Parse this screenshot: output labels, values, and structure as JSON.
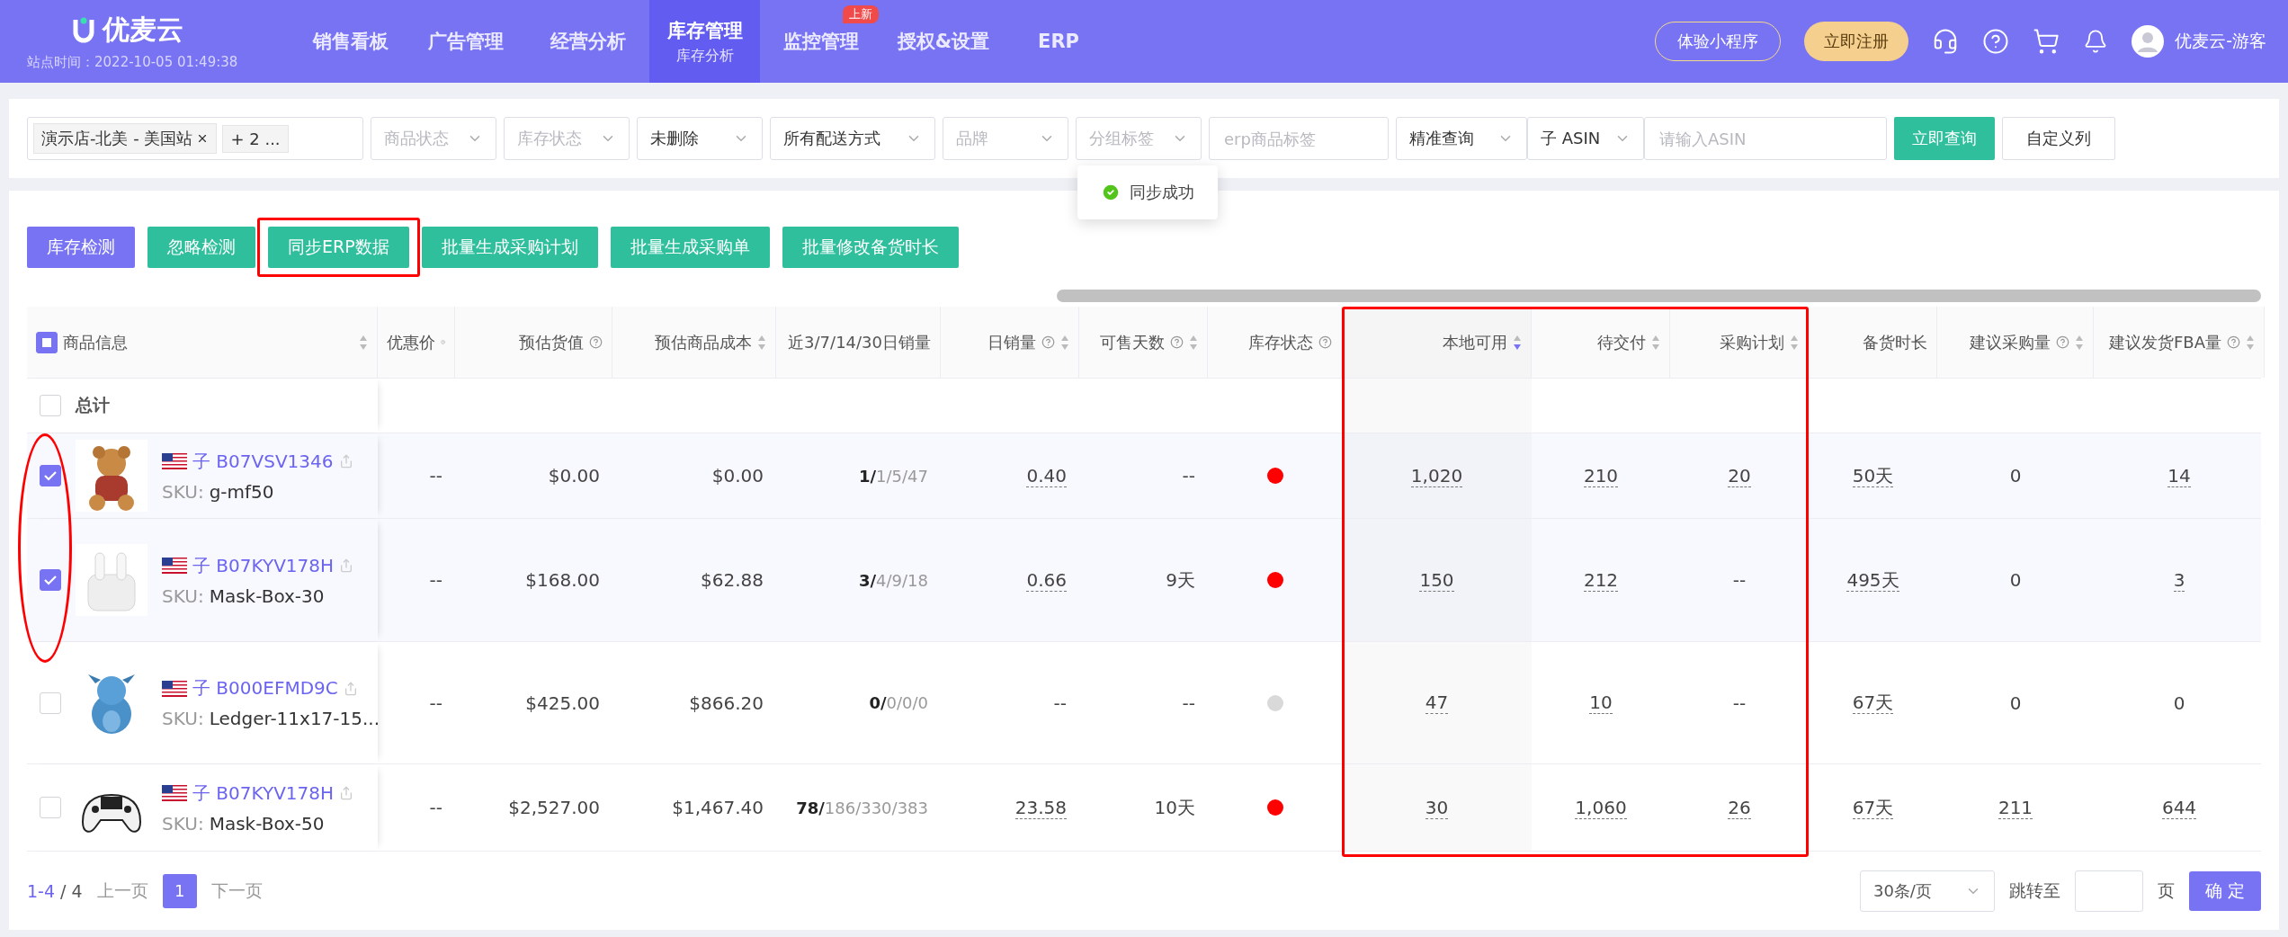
{
  "header": {
    "logo": "优麦云",
    "site_time": "站点时间：2022-10-05 01:49:38",
    "nav": [
      {
        "label": "销售看板",
        "selected": false
      },
      {
        "label": "广告管理",
        "selected": false
      },
      {
        "label": "经营分析",
        "selected": false
      },
      {
        "label": "库存管理",
        "sub": "库存分析",
        "selected": true
      },
      {
        "label": "监控管理",
        "badge": "上新",
        "selected": false
      },
      {
        "label": "授权&设置",
        "selected": false
      },
      {
        "label": "ERP",
        "selected": false
      }
    ],
    "trial_button": "体验小程序",
    "register_button": "立即注册",
    "user": "优麦云-游客"
  },
  "filters": {
    "store": {
      "tag": "演示店-北美 - 美国站",
      "more": "+ 2 ..."
    },
    "selects": [
      {
        "placeholder": "商品状态"
      },
      {
        "placeholder": "库存状态"
      },
      {
        "value": "未删除"
      },
      {
        "value": "所有配送方式"
      },
      {
        "placeholder": "品牌"
      },
      {
        "placeholder": "分组标签"
      }
    ],
    "tag_field": {
      "placeholder": "erp商品标签"
    },
    "mode_select": "精准查询",
    "asin_select": "子 ASIN",
    "asin_field": {
      "placeholder": "请输入ASIN"
    },
    "query_button": "立即查询",
    "custom_button": "自定义列"
  },
  "toast": "同步成功",
  "actions": [
    {
      "label": "库存检测",
      "kind": "primary",
      "highlighted": false
    },
    {
      "label": "忽略检测",
      "kind": "teal",
      "highlighted": false
    },
    {
      "label": "同步ERP数据",
      "kind": "teal",
      "highlighted": true
    },
    {
      "label": "批量生成采购计划",
      "kind": "teal",
      "highlighted": false
    },
    {
      "label": "批量生成采购单",
      "kind": "teal",
      "highlighted": false
    },
    {
      "label": "批量修改备货时长",
      "kind": "teal",
      "highlighted": false
    }
  ],
  "table": {
    "select_all": {
      "partial": true
    },
    "columns": [
      {
        "label": "商品信息",
        "help": false,
        "sortable": true,
        "descending": false
      },
      {
        "label": "优惠价",
        "help": true,
        "sortable": false
      },
      {
        "label": "预估货值",
        "help": true,
        "sortable": false
      },
      {
        "label": "预估商品成本",
        "help": false,
        "sortable": true,
        "descending": false
      },
      {
        "label": "近3/7/14/30日销量",
        "help": false,
        "sortable": false
      },
      {
        "label": "日销量",
        "help": true,
        "sortable": true,
        "descending": false
      },
      {
        "label": "可售天数",
        "help": true,
        "sortable": true,
        "descending": false
      },
      {
        "label": "库存状态",
        "help": true,
        "sortable": false
      },
      {
        "label": "本地可用",
        "help": false,
        "sortable": true,
        "descending": true
      },
      {
        "label": "待交付",
        "help": false,
        "sortable": true,
        "descending": false
      },
      {
        "label": "采购计划",
        "help": false,
        "sortable": true,
        "descending": false
      },
      {
        "label": "备货时长",
        "help": false,
        "sortable": false
      },
      {
        "label": "建议采购量",
        "help": true,
        "sortable": true,
        "descending": false
      },
      {
        "label": "建议发货FBA量",
        "help": true,
        "sortable": true,
        "descending": false
      }
    ],
    "total": {
      "label": "总计",
      "checked": false
    },
    "rows": [
      {
        "checked": true,
        "cells": [
          {
            "kind": "product",
            "child": "子",
            "asin": "B07VSV1346",
            "sku_label": "SKU:",
            "sku": "g-mf50"
          },
          {
            "kind": "text",
            "text": "--"
          },
          {
            "kind": "text",
            "text": "$0.00"
          },
          {
            "kind": "text",
            "text": "$0.00"
          },
          {
            "kind": "sales",
            "bold": "1/",
            "rest": "1/5/47"
          },
          {
            "kind": "text",
            "text": "0.40",
            "dotted": true
          },
          {
            "kind": "text",
            "text": "--"
          },
          {
            "kind": "dot",
            "color": "#ff0000"
          },
          {
            "kind": "text",
            "text": "1,020",
            "dotted": true
          },
          {
            "kind": "text",
            "text": "210",
            "dotted": true
          },
          {
            "kind": "text",
            "text": "20",
            "dotted": true
          },
          {
            "kind": "text",
            "text": "50天",
            "dotted": true
          },
          {
            "kind": "text",
            "text": "0"
          },
          {
            "kind": "text",
            "text": "14",
            "dotted": true
          }
        ]
      },
      {
        "checked": true,
        "cells": [
          {
            "kind": "product",
            "child": "子",
            "asin": "B07KYV178H",
            "sku_label": "SKU:",
            "sku": "Mask-Box-30"
          },
          {
            "kind": "text",
            "text": "--"
          },
          {
            "kind": "text",
            "text": "$168.00"
          },
          {
            "kind": "text",
            "text": "$62.88"
          },
          {
            "kind": "sales",
            "bold": "3/",
            "rest": "4/9/18"
          },
          {
            "kind": "text",
            "text": "0.66",
            "dotted": true
          },
          {
            "kind": "text",
            "text": "9天"
          },
          {
            "kind": "dot",
            "color": "#ff0000"
          },
          {
            "kind": "text",
            "text": "150",
            "dotted": true
          },
          {
            "kind": "text",
            "text": "212",
            "dotted": true
          },
          {
            "kind": "text",
            "text": "--"
          },
          {
            "kind": "text",
            "text": "495天",
            "dotted": true
          },
          {
            "kind": "text",
            "text": "0"
          },
          {
            "kind": "text",
            "text": "3",
            "dotted": true
          }
        ]
      },
      {
        "checked": false,
        "cells": [
          {
            "kind": "product",
            "child": "子",
            "asin": "B000EFMD9C",
            "sku_label": "SKU:",
            "sku": "Ledger-11x17-15..."
          },
          {
            "kind": "text",
            "text": "--"
          },
          {
            "kind": "text",
            "text": "$425.00"
          },
          {
            "kind": "text",
            "text": "$866.20"
          },
          {
            "kind": "sales",
            "bold": "0/",
            "rest": "0/0/0"
          },
          {
            "kind": "text",
            "text": "--"
          },
          {
            "kind": "text",
            "text": "--"
          },
          {
            "kind": "dot",
            "color": "#d9d9d9"
          },
          {
            "kind": "text",
            "text": "47",
            "dotted": true
          },
          {
            "kind": "text",
            "text": "10",
            "dotted": true
          },
          {
            "kind": "text",
            "text": "--"
          },
          {
            "kind": "text",
            "text": "67天",
            "dotted": true
          },
          {
            "kind": "text",
            "text": "0"
          },
          {
            "kind": "text",
            "text": "0"
          }
        ]
      },
      {
        "checked": false,
        "cells": [
          {
            "kind": "product",
            "child": "子",
            "asin": "B07KYV178H",
            "sku_label": "SKU:",
            "sku": "Mask-Box-50"
          },
          {
            "kind": "text",
            "text": "--"
          },
          {
            "kind": "text",
            "text": "$2,527.00"
          },
          {
            "kind": "text",
            "text": "$1,467.40"
          },
          {
            "kind": "sales",
            "bold": "78/",
            "rest": "186/330/383"
          },
          {
            "kind": "text",
            "text": "23.58",
            "dotted": true
          },
          {
            "kind": "text",
            "text": "10天"
          },
          {
            "kind": "dot",
            "color": "#ff0000"
          },
          {
            "kind": "text",
            "text": "30",
            "dotted": true
          },
          {
            "kind": "text",
            "text": "1,060",
            "dotted": true
          },
          {
            "kind": "text",
            "text": "26",
            "dotted": true
          },
          {
            "kind": "text",
            "text": "67天",
            "dotted": true
          },
          {
            "kind": "text",
            "text": "211",
            "dotted": true
          },
          {
            "kind": "text",
            "text": "644",
            "dotted": true
          }
        ]
      }
    ]
  },
  "pagination": {
    "range": "1-4",
    "total": "/ 4",
    "prev": "上一页",
    "pages": [
      {
        "label": "1",
        "selected": true
      }
    ],
    "next": "下一页",
    "page_size": "30条/页",
    "jump_label": "跳转至",
    "page_unit": "页",
    "confirm": "确 定"
  }
}
